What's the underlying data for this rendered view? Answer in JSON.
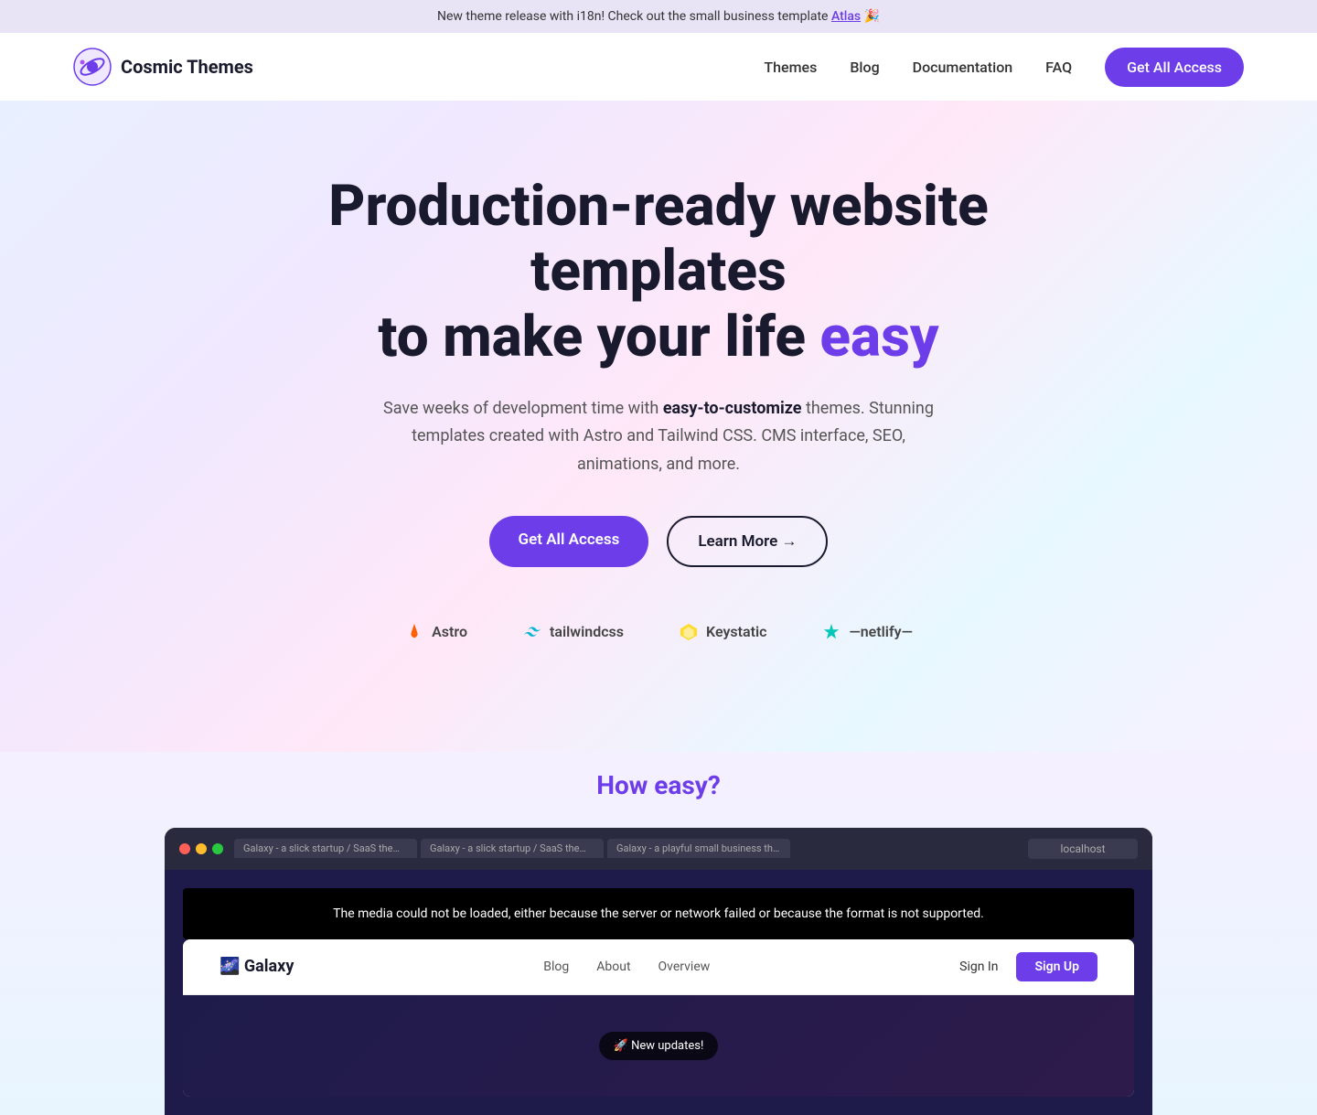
{
  "announcement": {
    "text": "New theme release with i18n! Check out the small business template ",
    "link_text": "Atlas",
    "emoji": "🎉"
  },
  "navbar": {
    "logo_name": "Cosmic Themes",
    "links": [
      {
        "label": "Themes",
        "href": "#"
      },
      {
        "label": "Blog",
        "href": "#"
      },
      {
        "label": "Documentation",
        "href": "#"
      },
      {
        "label": "FAQ",
        "href": "#"
      }
    ],
    "cta_label": "Get All Access"
  },
  "hero": {
    "title_part1": "Production-ready website templates",
    "title_part2": "to make your life ",
    "title_accent": "easy",
    "subtitle_normal1": "Save weeks of development time with ",
    "subtitle_bold": "easy-to-customize",
    "subtitle_normal2": " themes. Stunning templates created with Astro and Tailwind CSS. CMS interface, SEO, animations, and more.",
    "btn_primary": "Get All Access",
    "btn_secondary": "Learn More →"
  },
  "brands": [
    {
      "name": "Astro",
      "icon": "astro"
    },
    {
      "name": "tailwindcss",
      "icon": "tailwind"
    },
    {
      "name": "Keystatic",
      "icon": "keystatic"
    },
    {
      "name": "netlify",
      "icon": "netlify"
    }
  ],
  "how_easy": {
    "title": "How easy?"
  },
  "browser": {
    "tabs": [
      "Galaxy - a slick startup / SaaS theme built using Astro and...",
      "Galaxy - a slick startup / SaaS theme built using Astro and...",
      "Galaxy - a playful small business theme built using Astro a..."
    ],
    "address": "localhost",
    "media_error": "The media could not be loaded, either because the server or network failed or because the format is not supported.",
    "inner_nav": {
      "logo": "🌌 Galaxy",
      "links": [
        "Blog",
        "About",
        "Overview"
      ],
      "signin": "Sign In",
      "signup": "Sign Up"
    },
    "notification": "🚀 New updates!"
  }
}
